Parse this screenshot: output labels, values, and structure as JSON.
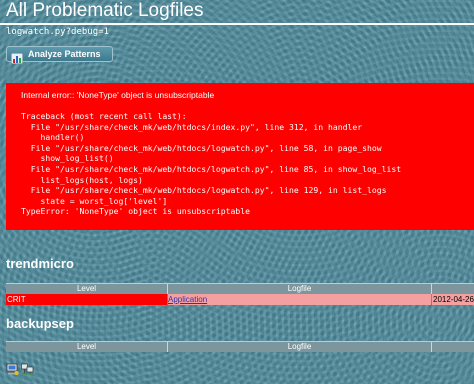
{
  "page": {
    "title": "All Problematic Logfiles",
    "url": "logwatch.py?debug=1"
  },
  "toolbar": {
    "analyze_label": "Analyze Patterns"
  },
  "error": {
    "message": "Internal error:: 'NoneType' object is unsubscriptable",
    "traceback": "Traceback (most recent call last):\n  File \"/usr/share/check_mk/web/htdocs/index.py\", line 312, in handler\n    handler()\n  File \"/usr/share/check_mk/web/htdocs/logwatch.py\", line 58, in page_show\n    show_log_list()\n  File \"/usr/share/check_mk/web/htdocs/logwatch.py\", line 85, in show_log_list\n    list_logs(host, logs)\n  File \"/usr/share/check_mk/web/htdocs/logwatch.py\", line 129, in list_logs\n    state = worst_log['level']\nTypeError: 'NoneType' object is unsubscriptable"
  },
  "hosts": [
    {
      "name": "trendmicro",
      "columns": [
        "Level",
        "Logfile"
      ],
      "rows": [
        {
          "level": "CRIT",
          "logfile": "Application",
          "date": "2012-04-26"
        }
      ]
    },
    {
      "name": "backupsep",
      "columns": [
        "Level",
        "Logfile"
      ],
      "rows": []
    }
  ],
  "colors": {
    "background": "#4e8ea0",
    "error_box": "#ff0000",
    "crit": "#ff0000",
    "row_highlight": "#f5a0a0",
    "table_header": "#7d969e"
  },
  "icons": {
    "analyze": "analyze-patterns-icon",
    "footer_left": "computer-icon",
    "footer_right": "network-hosts-icon"
  }
}
